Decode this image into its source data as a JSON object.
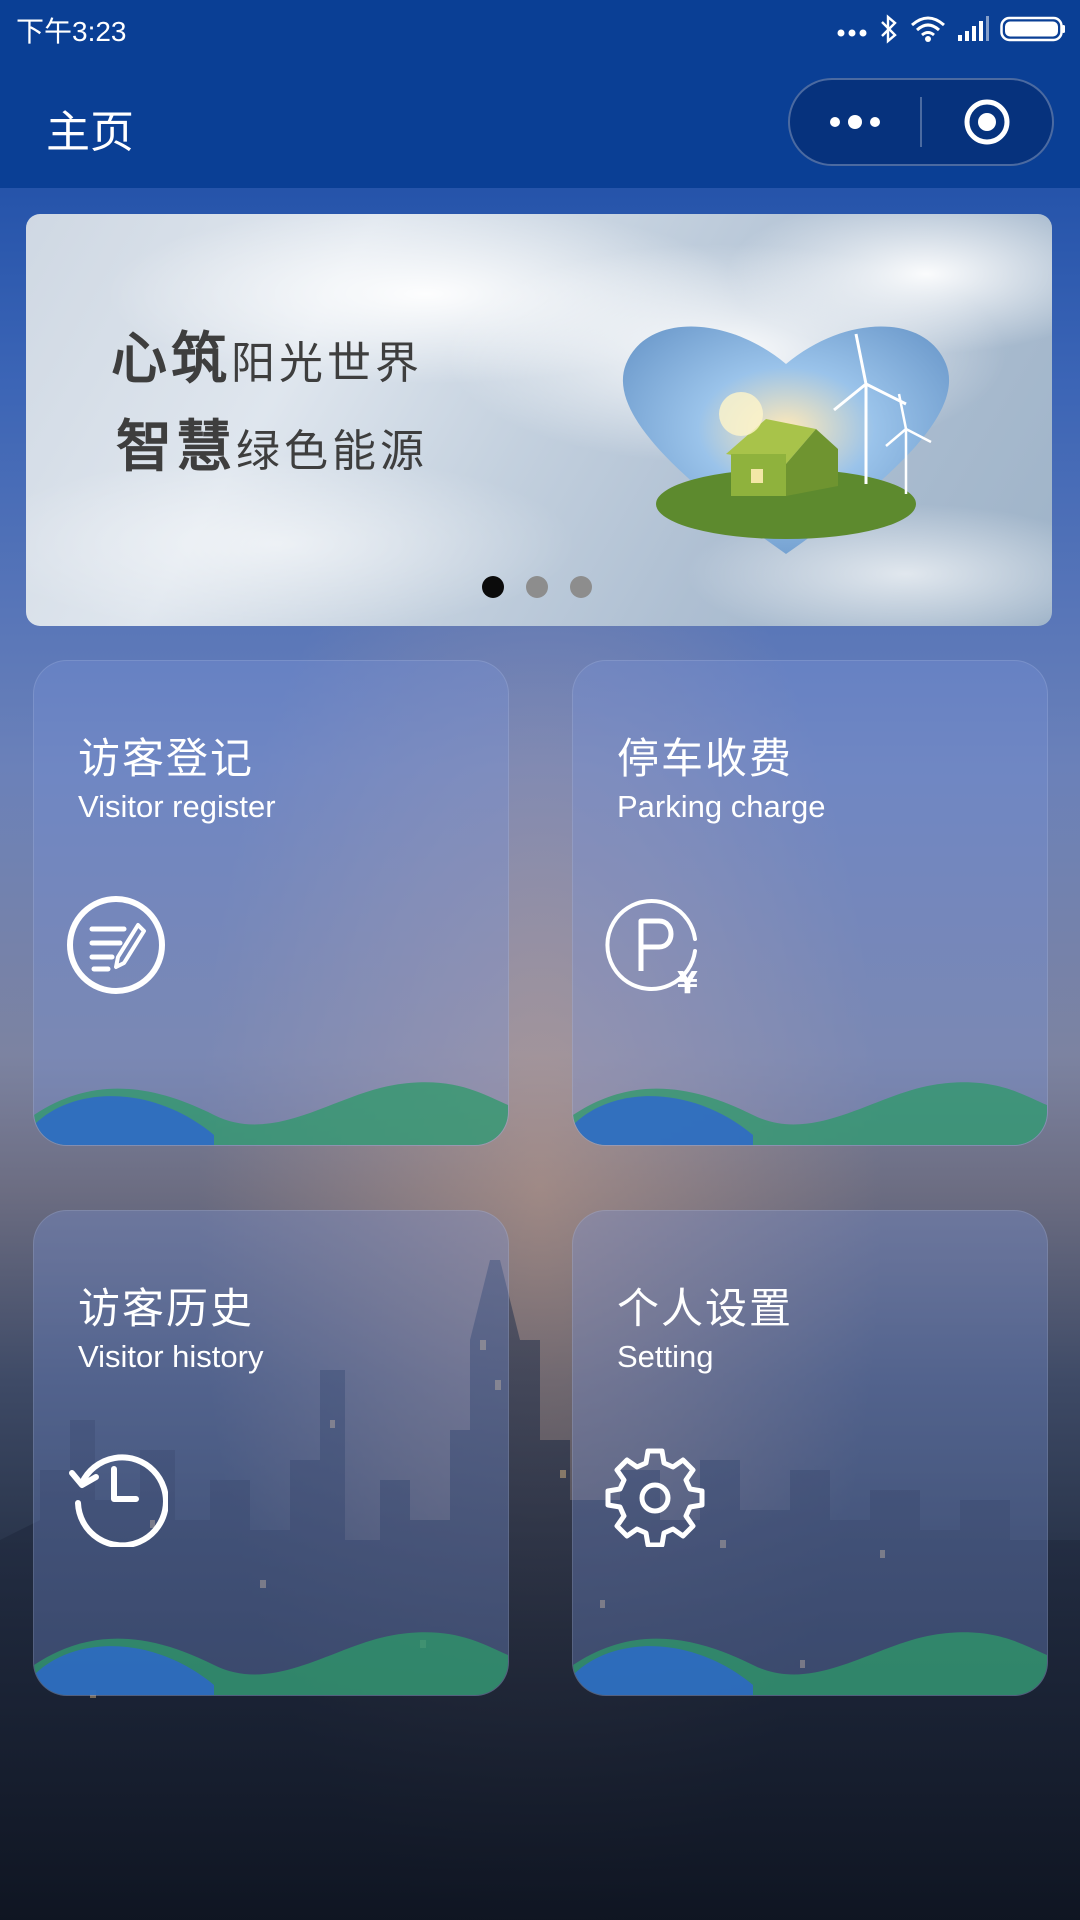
{
  "status_bar": {
    "time": "下午3:23",
    "icons": [
      "more-dots-icon",
      "bluetooth-icon",
      "wifi-icon",
      "signal-icon",
      "battery-icon"
    ]
  },
  "nav": {
    "title": "主页",
    "capsule": [
      "more-icon",
      "target-icon"
    ]
  },
  "banner": {
    "line1_bold": "心筑",
    "line1_rest": "阳光世界",
    "line2_bold": "智慧",
    "line2_rest": "绿色能源",
    "dots_total": 3,
    "active_dot": 0
  },
  "tiles": [
    {
      "title": "访客登记",
      "subtitle": "Visitor register",
      "icon": "register-icon"
    },
    {
      "title": "停车收费",
      "subtitle": "Parking charge",
      "icon": "parking-charge-icon"
    },
    {
      "title": "访客历史",
      "subtitle": "Visitor history",
      "icon": "history-icon"
    },
    {
      "title": "个人设置",
      "subtitle": "Setting",
      "icon": "gear-icon"
    }
  ],
  "colors": {
    "nav_background": "#0a3f95",
    "wave_blue": "#2c63d6",
    "wave_green": "#2e9a6a"
  }
}
